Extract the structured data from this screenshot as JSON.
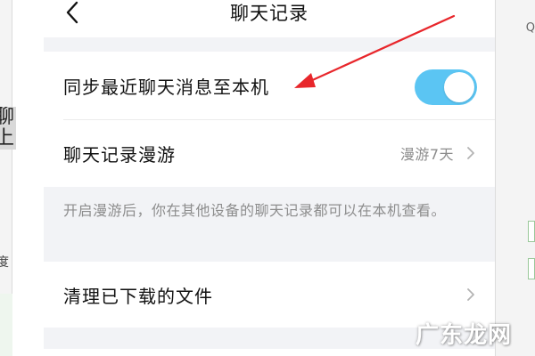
{
  "background": {
    "left_snippet_chars": "聊\n上",
    "left_text": "度",
    "right_mark": "Q"
  },
  "navbar": {
    "back_icon": "chevron-left-icon",
    "title": "聊天记录"
  },
  "settings": {
    "sync_recent": {
      "label": "同步最近聊天消息至本机",
      "enabled": true
    },
    "roaming": {
      "label": "聊天记录漫游",
      "value": "漫游7天",
      "icon": "chevron-right-icon"
    },
    "roaming_hint": "开启漫游后，你在其他设备的聊天记录都可以在本机查看。",
    "clear_downloads": {
      "label": "清理已下载的文件",
      "icon": "chevron-right-icon"
    }
  },
  "colors": {
    "toggle_on": "#5bc5f3",
    "annotation_arrow": "#e8262b",
    "page_bg": "#f2f3f6"
  },
  "watermark": "广东龙网"
}
